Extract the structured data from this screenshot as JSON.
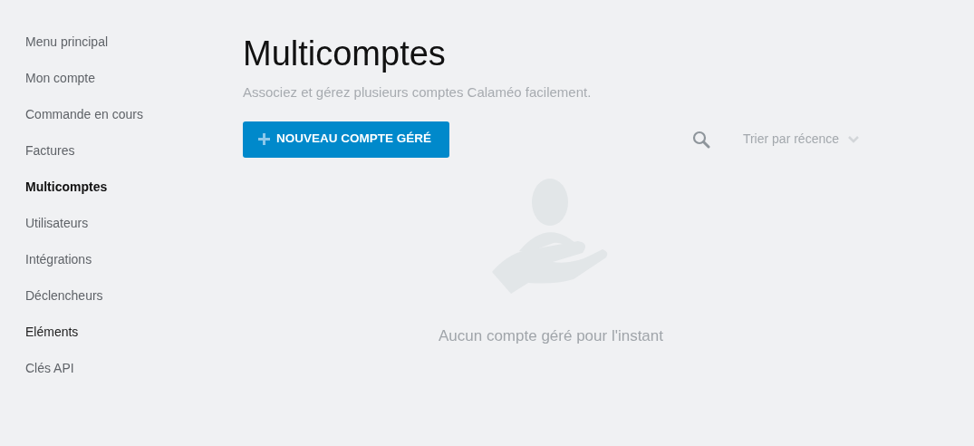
{
  "sidebar": {
    "items": [
      {
        "label": "Menu principal",
        "selected": false,
        "emphasized": false
      },
      {
        "label": "Mon compte",
        "selected": false,
        "emphasized": false
      },
      {
        "label": "Commande en cours",
        "selected": false,
        "emphasized": false
      },
      {
        "label": "Factures",
        "selected": false,
        "emphasized": false
      },
      {
        "label": "Multicomptes",
        "selected": true,
        "emphasized": false
      },
      {
        "label": "Utilisateurs",
        "selected": false,
        "emphasized": false
      },
      {
        "label": "Intégrations",
        "selected": false,
        "emphasized": false
      },
      {
        "label": "Déclencheurs",
        "selected": false,
        "emphasized": false
      },
      {
        "label": "Eléments",
        "selected": false,
        "emphasized": true
      },
      {
        "label": "Clés API",
        "selected": false,
        "emphasized": false
      }
    ]
  },
  "page": {
    "title": "Multicomptes",
    "subtitle": "Associez et gérez plusieurs comptes Calaméo facilement.",
    "new_button": "NOUVEAU COMPTE GÉRÉ",
    "sort": "Trier par récence",
    "empty_message": "Aucun compte géré pour l'instant"
  }
}
